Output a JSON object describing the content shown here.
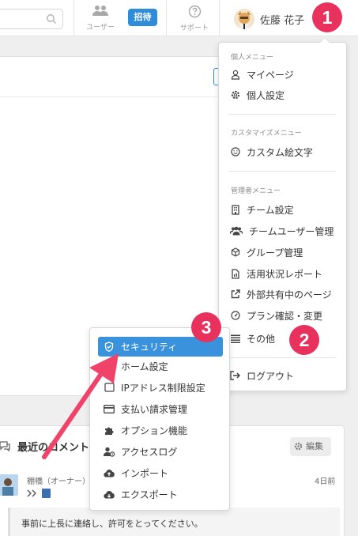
{
  "header": {
    "nav_users_label": "ユーザー",
    "invite_label": "招待",
    "nav_support_label": "サポート",
    "user_name": "佐藤 花子"
  },
  "badges": [
    "1",
    "2",
    "3"
  ],
  "user_menu": {
    "section_personal": "個人メニュー",
    "personal_items": [
      {
        "label": "マイページ",
        "icon": "person-icon"
      },
      {
        "label": "個人設定",
        "icon": "gear-icon"
      }
    ],
    "section_customize": "カスタマイズメニュー",
    "customize_items": [
      {
        "label": "カスタム絵文字",
        "icon": "smile-icon"
      }
    ],
    "section_admin": "管理者メニュー",
    "admin_items": [
      {
        "label": "チーム設定",
        "icon": "building-icon"
      },
      {
        "label": "チームユーザー管理",
        "icon": "users-icon"
      },
      {
        "label": "グループ管理",
        "icon": "cube-icon"
      },
      {
        "label": "活用状況レポート",
        "icon": "report-icon"
      },
      {
        "label": "外部共有中のページ",
        "icon": "external-link-icon"
      },
      {
        "label": "プラン確認・変更",
        "icon": "gauge-icon"
      },
      {
        "label": "その他",
        "icon": "list-icon"
      }
    ],
    "logout_label": "ログアウト"
  },
  "other_submenu": {
    "items": [
      {
        "label": "セキュリティ",
        "icon": "shield-icon",
        "selected": true
      },
      {
        "label": "ホーム設定",
        "icon": "home-icon"
      },
      {
        "label": "IPアドレス制限設定",
        "icon": "ip-icon"
      },
      {
        "label": "支払い請求管理",
        "icon": "credit-card-icon"
      },
      {
        "label": "オプション機能",
        "icon": "puzzle-icon"
      },
      {
        "label": "アクセスログ",
        "icon": "user-log-icon"
      },
      {
        "label": "インポート",
        "icon": "cloud-upload-icon"
      },
      {
        "label": "エクスポート",
        "icon": "cloud-download-icon"
      }
    ]
  },
  "comments": {
    "title": "最近のコメント",
    "edit_label": "編集",
    "commenter": "棚橋（オーナー）",
    "date": "4日前",
    "text": "事前に上長に連絡し、許可をとってください。"
  },
  "colors": {
    "accent": "#3a92dd",
    "badge": "#e8325d",
    "arrow": "#f0436a"
  }
}
